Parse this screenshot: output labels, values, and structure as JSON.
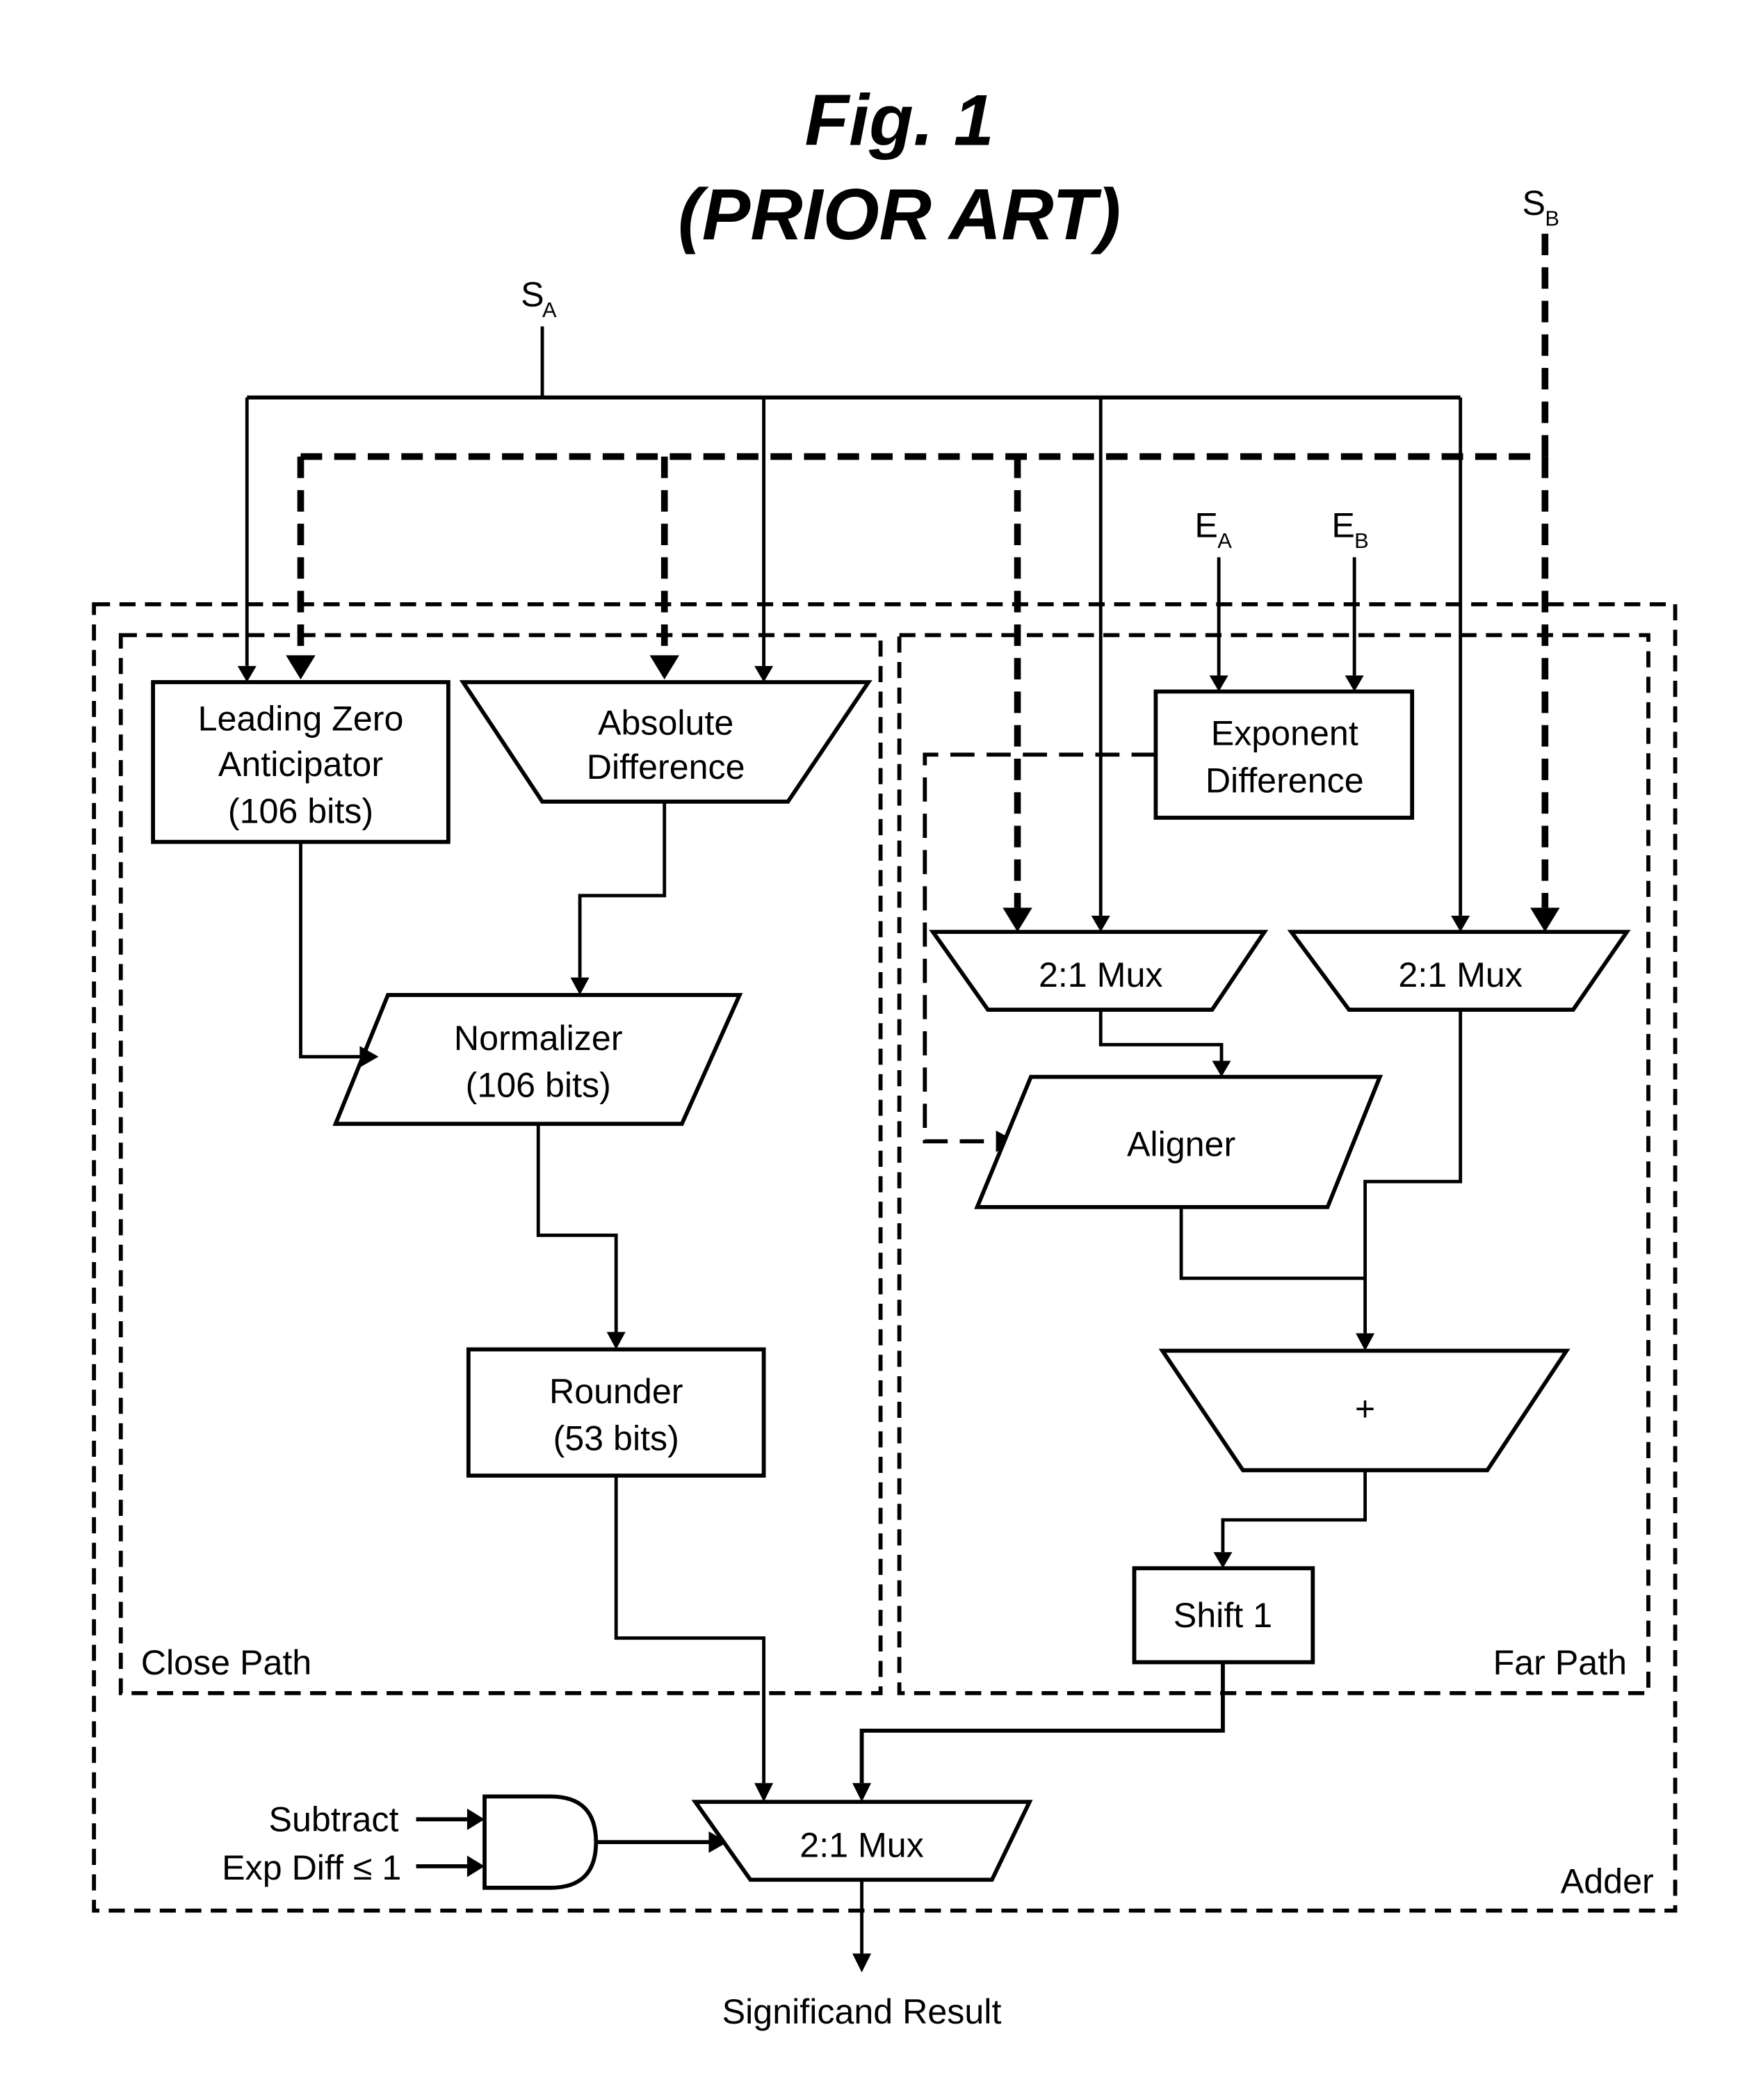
{
  "figure": {
    "title": "Fig. 1",
    "subtitle": "(PRIOR ART)"
  },
  "inputs": {
    "sa": {
      "main": "S",
      "sub": "A"
    },
    "sb": {
      "main": "S",
      "sub": "B"
    },
    "ea": {
      "main": "E",
      "sub": "A"
    },
    "eb": {
      "main": "E",
      "sub": "B"
    },
    "subtract": "Subtract",
    "exp_diff": "Exp Diff ≤ 1"
  },
  "regions": {
    "adder": "Adder",
    "close_path": "Close Path",
    "far_path": "Far Path"
  },
  "blocks": {
    "lza": [
      "Leading Zero",
      "Anticipator",
      "(106 bits)"
    ],
    "abs_diff": [
      "Absolute",
      "Difference"
    ],
    "normalizer": [
      "Normalizer",
      "(106 bits)"
    ],
    "rounder": [
      "Rounder",
      "(53 bits)"
    ],
    "exp_diff": [
      "Exponent",
      "Difference"
    ],
    "mux_left": "2:1 Mux",
    "mux_right": "2:1 Mux",
    "aligner": "Aligner",
    "adder_op": "+",
    "shift": "Shift 1",
    "mux_final": "2:1 Mux"
  },
  "output": "Significand Result"
}
